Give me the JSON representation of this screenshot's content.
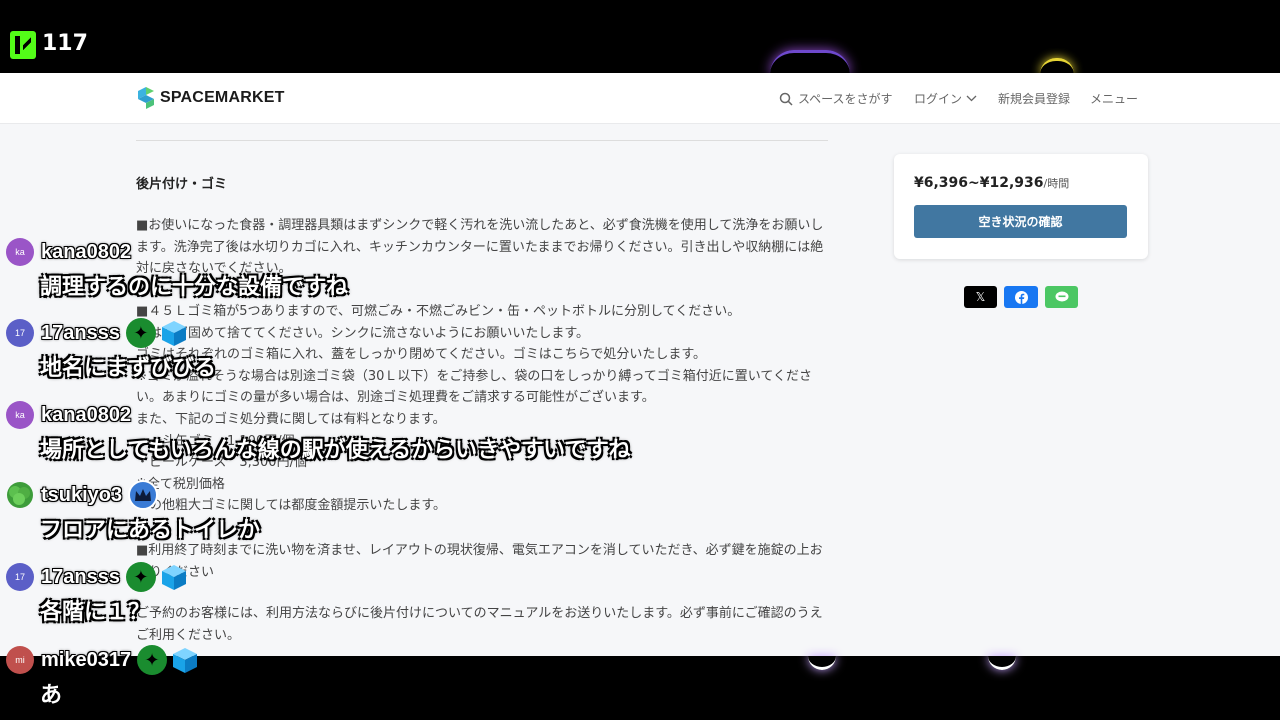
{
  "stream": {
    "viewer_count": "117"
  },
  "site": {
    "logo_text": "SPACEMARKET",
    "nav": {
      "search": "スペースをさがす",
      "login": "ログイン",
      "register": "新規会員登録",
      "menu": "メニュー"
    },
    "section_title": "後片付け・ゴミ",
    "paragraphs": [
      "■お使いになった食器・調理器具類はまずシンクで軽く汚れを洗い流したあと、必ず食洗機を使用して洗浄をお願いします。洗浄完了後は水切りカゴに入れ、キッチンカウンターに置いたままでお帰りください。引き出しや収納棚には絶対に戻さないでください。",
      "■４５Ｌゴミ箱が5つありますので、可燃ごみ・不燃ごみビン・缶・ペットボトルに分別してください。\n油は必ず固めて捨ててください。シンクに流さないようにお願いいたします。\nゴミはそれぞれのゴミ箱に入れ、蓋をしっかり閉めてください。ゴミはこちらで処分いたします。\n※ゴミが溢れそうな場合は別途ゴミ袋（30Ｌ以下）をご持参し、袋の口をしっかり縛ってゴミ箱付近に置いてください。あまりにゴミの量が多い場合は、別途ゴミ処理費をご請求する可能性がございます。\nまた、下記のゴミ処分費に関しては有料となります。\n・一斗缶ゴミ　1,100円/個\n・ビールケース　3,300円/個\n※全て税別価格\nその他粗大ゴミに関しては都度金額提示いたします。",
      "■利用終了時刻までに洗い物を済ませ、レイアウトの現状復帰、電気エアコンを消していただき、必ず鍵を施錠の上お帰りください",
      "ご予約のお客様には、利用方法ならびに後片付けについてのマニュアルをお送りいたします。必ず事前にご確認のうえご利用ください。"
    ],
    "price": "¥6,396~¥12,936",
    "price_unit": "/時間",
    "availability_button": "空き状況の確認",
    "share": {
      "x": "𝕏"
    }
  },
  "chat": [
    {
      "avatar": "ka",
      "avatar_color": "#9a55c7",
      "username": "kana0802",
      "badges": [],
      "text": "調理するのに十分な設備ですね"
    },
    {
      "avatar": "17",
      "avatar_color": "#5b5fc7",
      "username": "17ansss",
      "badges": [
        "star",
        "cube"
      ],
      "text": "地名にまずびびる"
    },
    {
      "avatar": "ka",
      "avatar_color": "#9a55c7",
      "username": "kana0802",
      "badges": [],
      "text": "場所としてもいろんな線の駅が使えるからいきやすいですね"
    },
    {
      "avatar": "",
      "avatar_color": "#3d9c3a",
      "username": "tsukiyo3",
      "badges": [
        "crown"
      ],
      "text": "フロアにあるトイレか"
    },
    {
      "avatar": "17",
      "avatar_color": "#5b5fc7",
      "username": "17ansss",
      "badges": [
        "star",
        "cube"
      ],
      "text": "各階に１？"
    },
    {
      "avatar": "mi",
      "avatar_color": "#c0504d",
      "username": "mike0317",
      "badges": [
        "star",
        "cube"
      ],
      "text": "あ"
    }
  ]
}
